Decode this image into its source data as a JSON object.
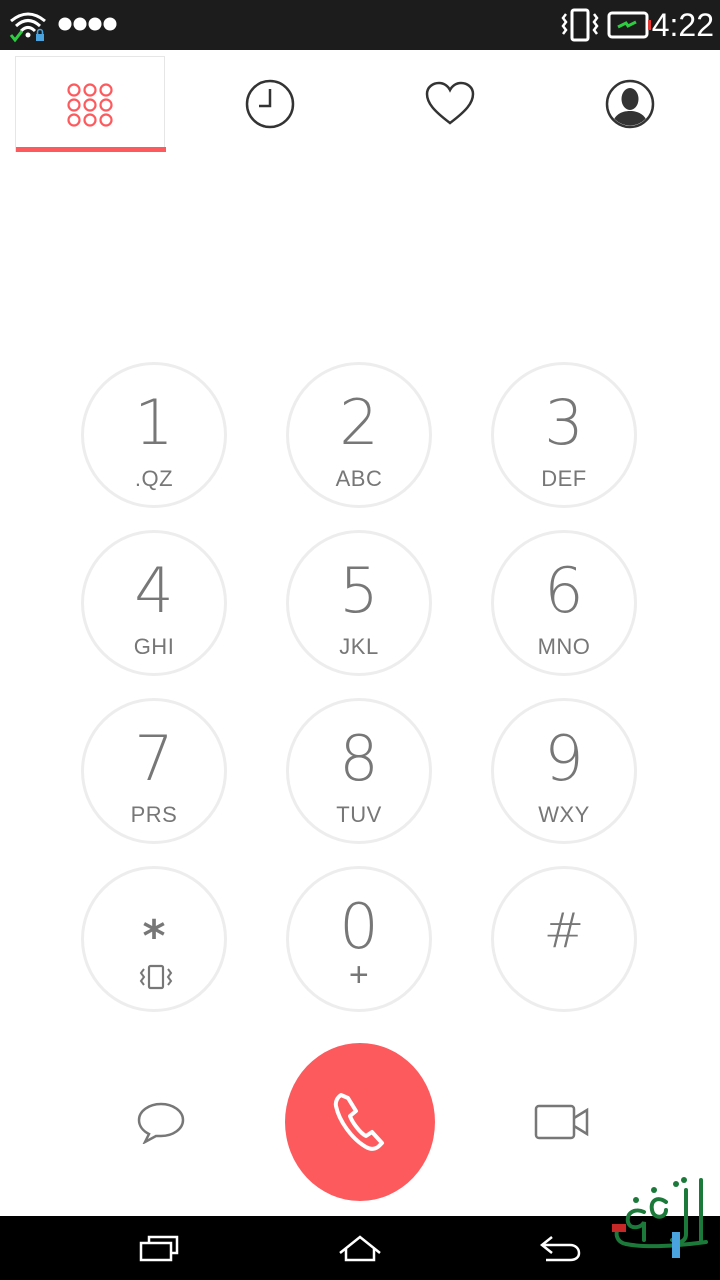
{
  "status": {
    "time": "4:22"
  },
  "tabs": [
    {
      "name": "dialpad"
    },
    {
      "name": "recents"
    },
    {
      "name": "favorites"
    },
    {
      "name": "contacts"
    }
  ],
  "dialer": {
    "number": ""
  },
  "keypad": [
    {
      "num": "1",
      "letters": ".QZ"
    },
    {
      "num": "2",
      "letters": "ABC"
    },
    {
      "num": "3",
      "letters": "DEF"
    },
    {
      "num": "4",
      "letters": "GHI"
    },
    {
      "num": "5",
      "letters": "JKL"
    },
    {
      "num": "6",
      "letters": "MNO"
    },
    {
      "num": "7",
      "letters": "PRS"
    },
    {
      "num": "8",
      "letters": "TUV"
    },
    {
      "num": "9",
      "letters": "WXY"
    },
    {
      "num": "*",
      "letters": ""
    },
    {
      "num": "0",
      "letters": "+"
    },
    {
      "num": "#",
      "letters": ""
    }
  ],
  "colors": {
    "accent": "#fd5a5e",
    "key_border": "#ededed",
    "text": "#777777",
    "statusbar": "#1c1c1c"
  }
}
